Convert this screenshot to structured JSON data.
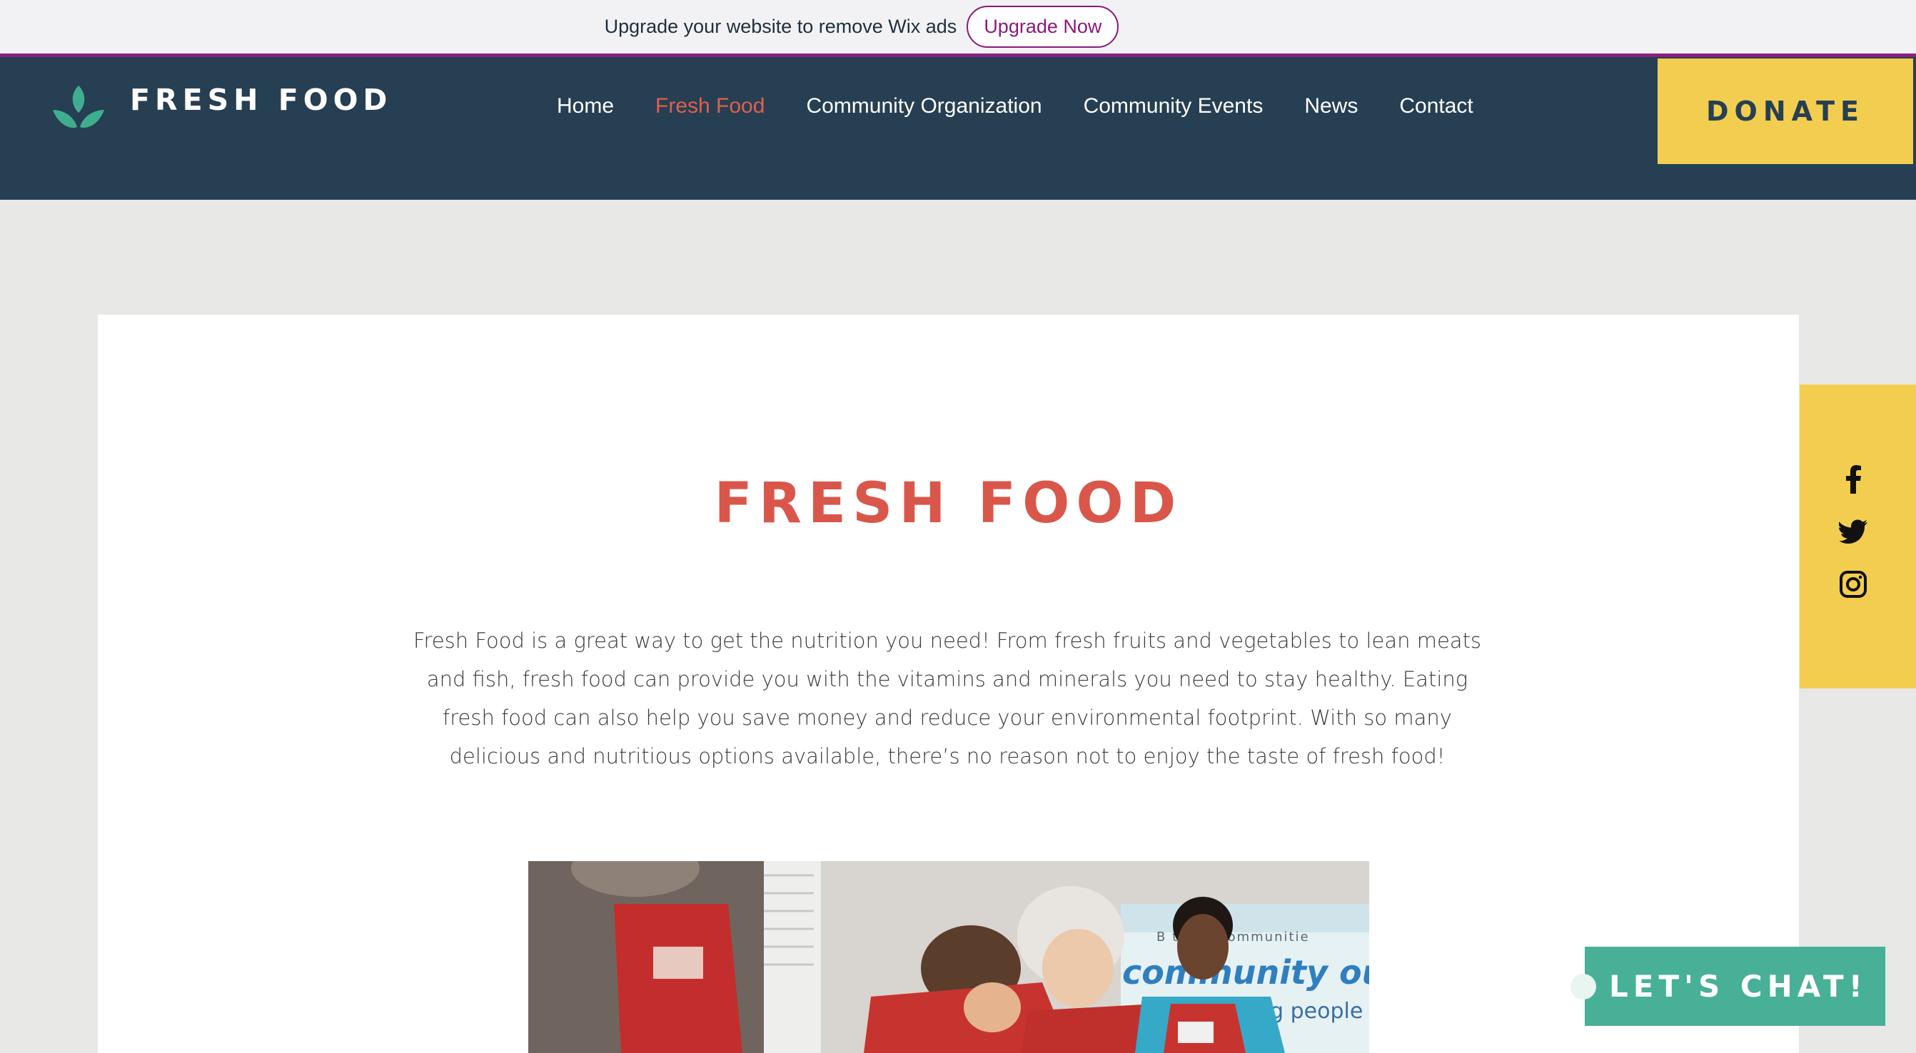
{
  "wix_banner": {
    "message": "Upgrade your website to remove Wix ads",
    "button": "Upgrade Now"
  },
  "header": {
    "logo_text": "FRESH FOOD",
    "nav": [
      {
        "label": "Home",
        "active": false
      },
      {
        "label": "Fresh Food",
        "active": true
      },
      {
        "label": "Community Organization",
        "active": false
      },
      {
        "label": "Community Events",
        "active": false
      },
      {
        "label": "News",
        "active": false
      },
      {
        "label": "Contact",
        "active": false
      }
    ],
    "donate": "DONATE"
  },
  "main": {
    "title": "FRESH FOOD",
    "body": "Fresh Food is a great way to get the nutrition you need! From fresh fruits and vegetables to lean meats and fish, fresh food can provide you with the vitamins and minerals you need to stay healthy. Eating fresh food can also help you save money and reduce your environmental footprint. With so many delicious and nutritious options available, there’s no reason not to enjoy the taste of fresh food!"
  },
  "photo": {
    "banner_line1": "B        trong communitie",
    "banner_line2": "community outrea",
    "banner_line3": "ng people"
  },
  "social": {
    "icons": [
      "facebook-icon",
      "twitter-icon",
      "instagram-icon"
    ]
  },
  "chat": {
    "label": "LET'S CHAT!"
  },
  "colors": {
    "header_bg": "#263f52",
    "accent_red": "#d9574a",
    "donate_yellow": "#f3cd4f",
    "chat_green": "#48b096",
    "wix_purple": "#8a1f80"
  }
}
